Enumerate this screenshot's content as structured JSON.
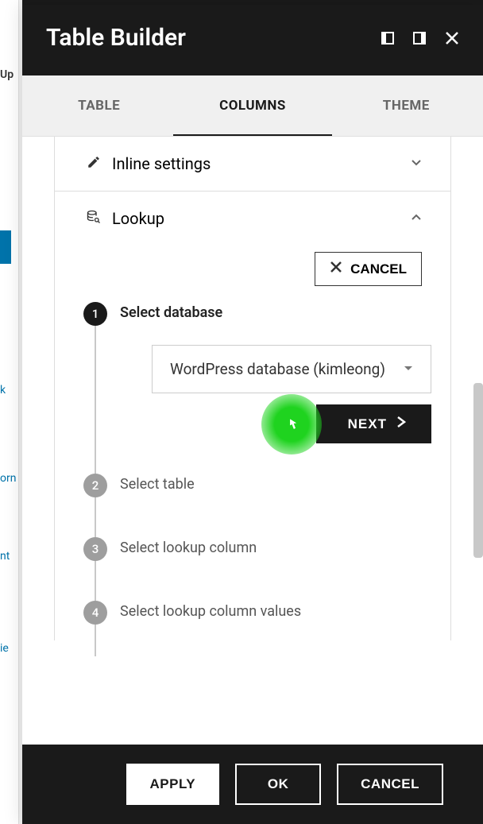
{
  "header": {
    "title": "Table Builder"
  },
  "tabs": {
    "table": "TABLE",
    "columns": "COLUMNS",
    "theme": "THEME"
  },
  "sections": {
    "inline": {
      "title": "Inline settings"
    },
    "lookup": {
      "title": "Lookup",
      "cancel_label": "CANCEL",
      "steps": {
        "s1": {
          "num": "1",
          "label": "Select database"
        },
        "s2": {
          "num": "2",
          "label": "Select table"
        },
        "s3": {
          "num": "3",
          "label": "Select lookup column"
        },
        "s4": {
          "num": "4",
          "label": "Select lookup column values"
        }
      },
      "db_select": "WordPress database (kimleong)",
      "next_label": "NEXT"
    }
  },
  "footer": {
    "apply": "APPLY",
    "ok": "OK",
    "cancel": "CANCEL"
  },
  "bg": {
    "up": "Up",
    "k": "k",
    "orn": "orn",
    "nt": "nt",
    "ie": "ie"
  }
}
